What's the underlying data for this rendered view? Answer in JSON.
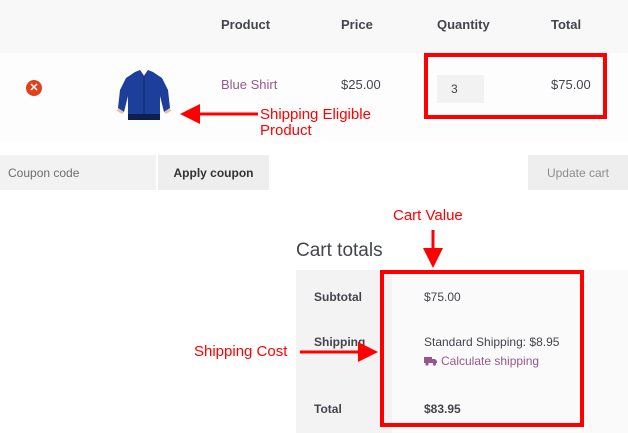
{
  "table": {
    "headers": [
      "Product",
      "Price",
      "Quantity",
      "Total"
    ],
    "item": {
      "remove_symbol": "✕",
      "product_image": "blue-shirt-image",
      "name": "Blue Shirt",
      "price": "$25.00",
      "quantity": "3",
      "total": "$75.00"
    }
  },
  "actions": {
    "coupon_placeholder": "Coupon code",
    "apply_label": "Apply coupon",
    "update_label": "Update cart"
  },
  "totals": {
    "title": "Cart totals",
    "subtotal_label": "Subtotal",
    "subtotal_value": "$75.00",
    "shipping_label": "Shipping",
    "shipping_value": "Standard Shipping: $8.95",
    "calculate_label": "Calculate shipping",
    "total_label": "Total",
    "total_value": "$83.95"
  },
  "annotations": {
    "product_line1": "Shipping Eligible",
    "product_line2": "Product",
    "cart_value": "Cart Value",
    "shipping_cost": "Shipping Cost",
    "color": "#ff0000"
  },
  "colors": {
    "link": "#96588a",
    "remove": "#e2401c"
  }
}
